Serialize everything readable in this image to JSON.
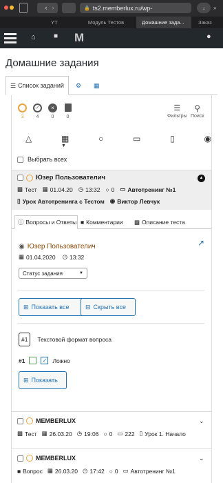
{
  "browser": {
    "url": "ts2.memberlux.ru/wp-",
    "tabs": [
      "YT",
      "Модуль Тестов",
      "Домашние зада...",
      "Заказ"
    ]
  },
  "page": {
    "title": "Домашние задания"
  },
  "tabs": {
    "list_label": "Список заданий"
  },
  "status_counts": [
    {
      "icon": "clock-icon",
      "count": "3",
      "color": "#e8a33c"
    },
    {
      "icon": "check-circle-icon",
      "count": "4",
      "color": "#555"
    },
    {
      "icon": "x-circle-icon",
      "count": "0",
      "color": "#555"
    },
    {
      "icon": "trash-icon",
      "count": "0",
      "color": "#555"
    }
  ],
  "tools": {
    "filters": "Фильтры",
    "search": "Поиск"
  },
  "select_all": "Выбрать всех",
  "item1": {
    "user": "Юзер Пользователич",
    "type": "Тест",
    "date": "01.04.20",
    "time": "13:32",
    "comments": "0",
    "course": "Автотренинг №1",
    "lesson": "Урок Автотренинга с Тестом",
    "author": "Виктор Левчук"
  },
  "subtabs": [
    "Вопросы и Ответы",
    "Комментарии",
    "Описание теста"
  ],
  "detail": {
    "user": "Юзер Пользователич",
    "date": "01.04.2020",
    "time": "13:32",
    "status_placeholder": "Статус задания",
    "show_all": "Показать все",
    "hide_all": "Скрыть все",
    "q_num": "#1",
    "q_text": "Текстовой формат вопроса",
    "a_num": "#1",
    "a_text": "Ложно",
    "show": "Показать"
  },
  "item2": {
    "user": "MEMBERLUX",
    "type": "Тест",
    "date": "26.03.20",
    "time": "19:06",
    "comments": "0",
    "views": "222",
    "course": "Урок 1. Начало"
  },
  "item3": {
    "user": "MEMBERLUX",
    "type": "Вопрос",
    "date": "26.03.20",
    "time": "17:42",
    "comments": "0",
    "course": "Автотренинг №1"
  }
}
